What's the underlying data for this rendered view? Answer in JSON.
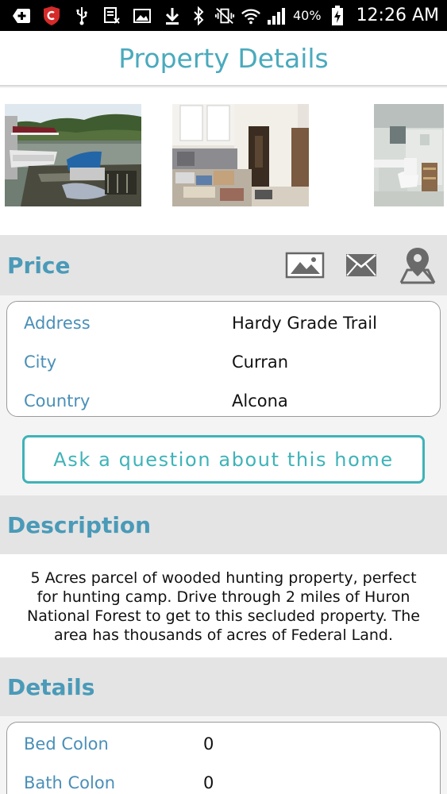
{
  "status_bar": {
    "battery": "40%",
    "time": "12:26 AM"
  },
  "header": {
    "title": "Property Details"
  },
  "gallery": {
    "photos": [
      "lake-dock-photo",
      "room-interior-photo",
      "bathroom-photo"
    ]
  },
  "price_section": {
    "title": "Price",
    "actions": [
      "image-icon",
      "mail-icon",
      "map-pin-icon"
    ]
  },
  "address_card": {
    "rows": [
      {
        "label": "Address",
        "value": "Hardy Grade Trail"
      },
      {
        "label": "City",
        "value": "Curran"
      },
      {
        "label": "Country",
        "value": "Alcona"
      }
    ]
  },
  "ask_button": {
    "label": "Ask a question about this home"
  },
  "description_section": {
    "title": "Description",
    "text": "5 Acres parcel of wooded hunting property, perfect for hunting camp. Drive through 2 miles of Huron National Forest to get to this secluded property. The area has thousands of acres of Federal Land."
  },
  "details_section": {
    "title": "Details",
    "rows": [
      {
        "label": "Bed Colon",
        "value": "0"
      },
      {
        "label": "Bath Colon",
        "value": "0"
      }
    ]
  },
  "colors": {
    "accent_teal": "#4aaabd",
    "label_blue": "#4a8fb8",
    "section_bg": "#e4e4e4"
  }
}
